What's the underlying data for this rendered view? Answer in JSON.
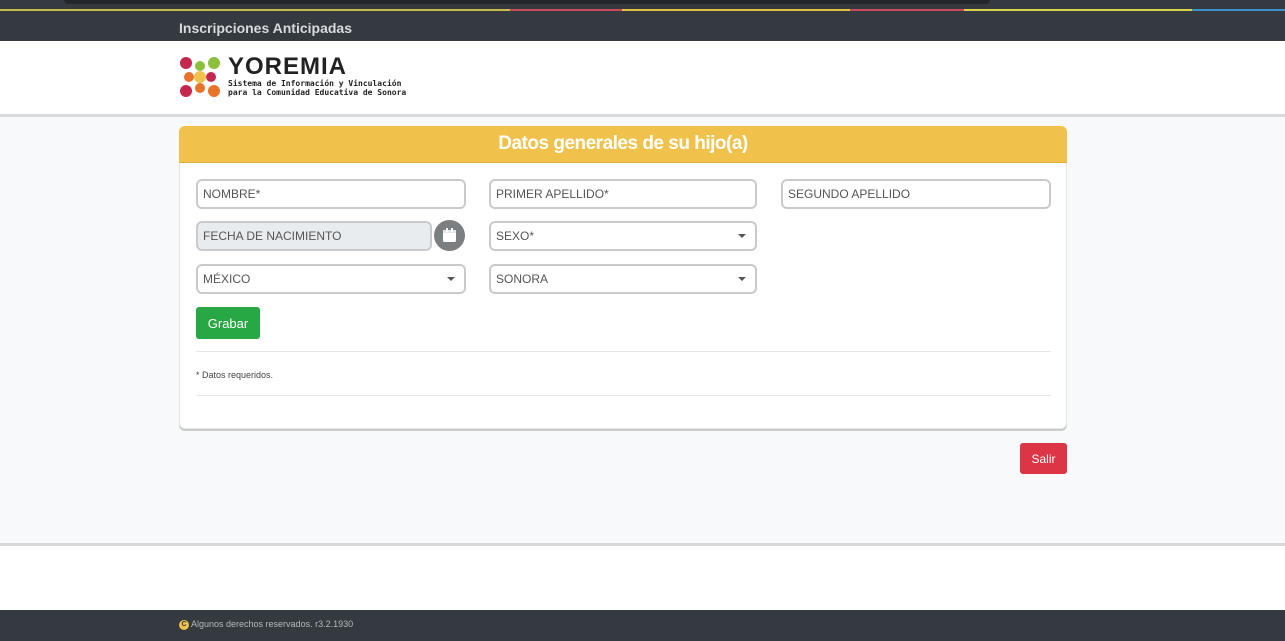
{
  "app": {
    "title": "Inscripciones Anticipadas"
  },
  "logo": {
    "name": "YOREMIA",
    "subtitle_line1": "Sistema de Información y Vinculación",
    "subtitle_line2": "para la Comunidad Educativa de Sonora"
  },
  "form": {
    "heading": "Datos generales de su hijo(a)",
    "fields": {
      "nombre": {
        "placeholder": "NOMBRE*"
      },
      "primer_apellido": {
        "placeholder": "PRIMER APELLIDO*"
      },
      "segundo_apellido": {
        "placeholder": "SEGUNDO APELLIDO"
      },
      "fecha_nacimiento": {
        "placeholder": "FECHA DE NACIMIENTO"
      },
      "sexo": {
        "value": "SEXO*"
      },
      "pais": {
        "value": "MÉXICO"
      },
      "estado": {
        "value": "SONORA"
      }
    },
    "save_label": "Grabar",
    "required_note": "* Datos requeridos."
  },
  "exit_label": "Salir",
  "footer": {
    "copy_symbol": "C",
    "text": "Algunos derechos reservados. r3.2.1930"
  },
  "colors": {
    "header_bar": "#343a40",
    "card_header": "#f1c24b",
    "save_button": "#28a745",
    "exit_button": "#dc3545"
  },
  "icons": {
    "calendar": "calendar-icon",
    "dropdown": "caret-down-icon",
    "copyright": "copyright-icon"
  }
}
